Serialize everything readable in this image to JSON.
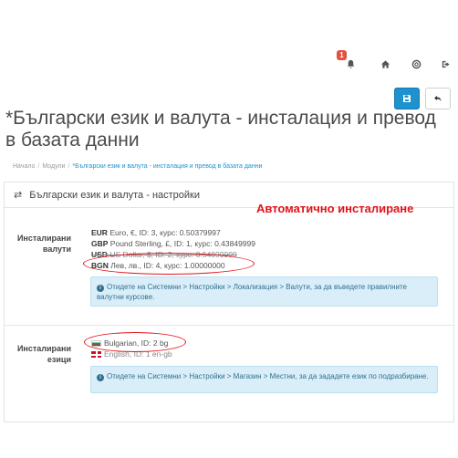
{
  "topbar": {
    "notifications_count": "1"
  },
  "header": {
    "title": "*Български език и валута - инсталация и превод в базата данни"
  },
  "breadcrumb": {
    "home": "Начало",
    "modules": "Модули",
    "current": "*Български език и валута - инсталация и превод в базата данни"
  },
  "panel": {
    "title": "Български език и валута - настройки",
    "annotation": "Автоматично инсталиране",
    "currencies": {
      "label_line1": "Инсталирани",
      "label_line2": "валути",
      "items": [
        {
          "code": "EUR",
          "desc": "Euro, €, ID: 3, курс: 0.50379997",
          "struck": false
        },
        {
          "code": "GBP",
          "desc": "Pound Sterling, £, ID: 1, курс: 0.43849999",
          "struck": false
        },
        {
          "code": "USD",
          "desc": "US Dollar, $, ID: 2, курс: 0.54899999",
          "struck": true
        },
        {
          "code": "BGN",
          "desc": "Лев, лв., ID: 4, курс: 1.00000000",
          "struck": false
        }
      ],
      "info": "Отидете на Системни > Настройки > Локализация > Валути, за да въведете правилните валутни курсове."
    },
    "languages": {
      "label_line1": "Инсталирани",
      "label_line2": "езици",
      "items": [
        {
          "text": "Bulgarian, ID: 2  bg",
          "flag": "bg"
        },
        {
          "text": "English, ID: 1  en-gb",
          "flag": "gb"
        }
      ],
      "info": "Отидете на Системни > Настройки > Магазин > Местни, за да зададете език по подразбиране."
    }
  },
  "colors": {
    "accent": "#1e91cf",
    "annotation_red": "#e0141c",
    "info_bg": "#d9eef8"
  },
  "icons": [
    "bell-icon",
    "home-icon",
    "lifebuoy-icon",
    "sign-out-icon",
    "save-icon",
    "back-icon",
    "exchange-icon",
    "info-icon"
  ]
}
